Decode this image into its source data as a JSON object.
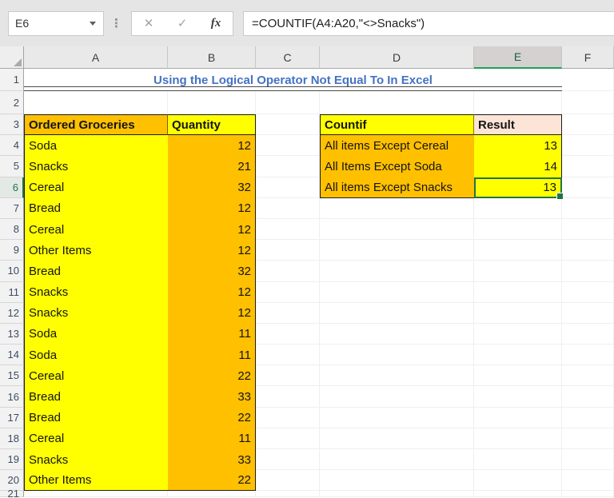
{
  "formula_bar": {
    "cell_reference": "E6",
    "dropdown_icon": "▼",
    "dots_icon": "⋮",
    "cancel_icon": "✕",
    "enter_icon": "✓",
    "fx_icon": "fx",
    "formula": "=COUNTIF(A4:A20,\"<>Snacks\")"
  },
  "column_headers": [
    "A",
    "B",
    "C",
    "D",
    "E",
    "F"
  ],
  "row_numbers": [
    1,
    2,
    3,
    4,
    5,
    6,
    7,
    8,
    9,
    10,
    11,
    12,
    13,
    14,
    15,
    16,
    17,
    18,
    19,
    20,
    21
  ],
  "title_row": {
    "title": "Using the Logical Operator Not Equal To In Excel"
  },
  "selection": {
    "active_cell": "E6",
    "selected_column": "E",
    "selected_row": 6
  },
  "groceries_table": {
    "item_header": "Ordered Groceries",
    "qty_header": "Quantity",
    "rows": [
      {
        "item": "Soda",
        "qty": 12
      },
      {
        "item": "Snacks",
        "qty": 21
      },
      {
        "item": "Cereal",
        "qty": 32
      },
      {
        "item": "Bread",
        "qty": 12
      },
      {
        "item": "Cereal",
        "qty": 12
      },
      {
        "item": "Other Items",
        "qty": 12
      },
      {
        "item": "Bread",
        "qty": 32
      },
      {
        "item": "Snacks",
        "qty": 12
      },
      {
        "item": "Snacks",
        "qty": 12
      },
      {
        "item": "Soda",
        "qty": 11
      },
      {
        "item": "Soda",
        "qty": 11
      },
      {
        "item": "Cereal",
        "qty": 22
      },
      {
        "item": "Bread",
        "qty": 33
      },
      {
        "item": "Bread",
        "qty": 22
      },
      {
        "item": "Cereal",
        "qty": 11
      },
      {
        "item": "Snacks",
        "qty": 33
      },
      {
        "item": "Other Items",
        "qty": 22
      }
    ]
  },
  "countif_table": {
    "label_header": "Countif",
    "result_header": "Result",
    "rows": [
      {
        "label": "All items Except Cereal",
        "result": 13
      },
      {
        "label": "All Items Except Soda",
        "result": 14
      },
      {
        "label": "All items Except Snacks",
        "result": 13
      }
    ]
  },
  "colors": {
    "yellow": "#FFFF00",
    "orange": "#FFC000",
    "peach": "#FCE4D6",
    "title_blue": "#4472C4",
    "excel_green": "#217346",
    "toolbar_gray": "#E5E5E5"
  }
}
